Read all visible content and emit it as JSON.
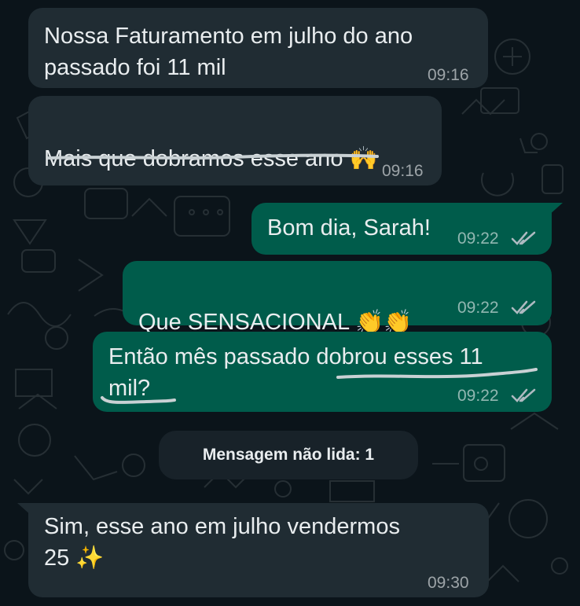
{
  "messages": [
    {
      "id": "m1",
      "direction": "incoming",
      "text": "Nossa Faturamento em julho do ano\npassado foi 11 mil",
      "time": "09:16"
    },
    {
      "id": "m2",
      "direction": "incoming",
      "text": "Mais que dobramos esse ano 🙌",
      "time": "09:16"
    },
    {
      "id": "m3",
      "direction": "outgoing",
      "text": "Bom dia, Sarah!",
      "time": "09:22",
      "status": "read"
    },
    {
      "id": "m4",
      "direction": "outgoing",
      "text": "Que SENSACIONAL 👏👏",
      "time": "09:22",
      "status": "read"
    },
    {
      "id": "m5",
      "direction": "outgoing",
      "text": "Então mês passado dobrou esses 11\nmil?",
      "time": "09:22",
      "status": "read"
    },
    {
      "id": "m6",
      "direction": "incoming",
      "text": "Sim, esse ano em julho vendermos\n25 ✨",
      "time": "09:30"
    }
  ],
  "unread_banner": {
    "text": "Mensagem não lida: 1"
  },
  "colors": {
    "background": "#0b141a",
    "incoming_bubble": "#202c33",
    "outgoing_bubble": "#005c4b",
    "text": "#e9edef",
    "meta_text": "#8696a0",
    "read_ticks": "#aebac1",
    "scribble": "#c9d1d4"
  },
  "icons": {
    "read_receipt": "double-check-icon"
  }
}
